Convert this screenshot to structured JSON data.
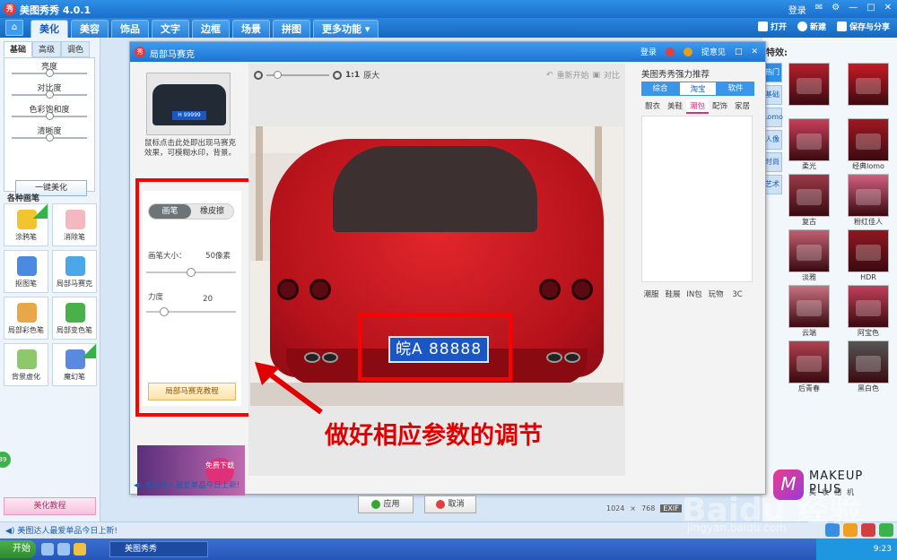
{
  "app": {
    "title": "美图秀秀 4.0.1",
    "logo_char": "秀",
    "login": "登录",
    "top_right": [
      "✉",
      "⚙",
      "—",
      "□",
      "✕"
    ]
  },
  "main_tabs": {
    "home_icon": "home-icon",
    "items": [
      "美化",
      "美容",
      "饰品",
      "文字",
      "边框",
      "场景",
      "拼图",
      "更多功能 ▾"
    ],
    "active": 0,
    "actions": {
      "open": "打开",
      "new": "新建",
      "save": "保存与分享"
    }
  },
  "left_panel": {
    "subtabs": [
      "基础",
      "高级",
      "调色"
    ],
    "sliders": [
      {
        "label": "亮度",
        "value": 0.5
      },
      {
        "label": "对比度",
        "value": 0.5
      },
      {
        "label": "色彩饱和度",
        "value": 0.5
      },
      {
        "label": "清晰度",
        "value": 0.5
      }
    ],
    "one_click": "一键美化",
    "brush_title": "各种画笔",
    "brushes": [
      {
        "label": "涂鸦笔",
        "color": "#f2c430",
        "tag": true
      },
      {
        "label": "消除笔",
        "color": "#f4b8c0",
        "tag": false
      },
      {
        "label": "抠图笔",
        "color": "#4a8ae0",
        "tag": false
      },
      {
        "label": "局部马赛克",
        "color": "#4aa8e8",
        "tag": false
      },
      {
        "label": "局部彩色笔",
        "color": "#e8a84a",
        "tag": false
      },
      {
        "label": "局部变色笔",
        "color": "#4ab04a",
        "tag": false
      },
      {
        "label": "背景虚化",
        "color": "#8ec86a",
        "tag": false
      },
      {
        "label": "魔幻笔",
        "color": "#5a8ae0",
        "tag": true
      }
    ],
    "tutorial": "美化教程",
    "badge": "39"
  },
  "dialog": {
    "title": "局部马赛克",
    "login": "登录",
    "feedback": "提意见",
    "hint": "鼠标点击此处即出现马赛克效果，可模糊水印，背景。",
    "thumb_plate": "H 99999",
    "tool_tabs": [
      "画笔",
      "橡皮擦"
    ],
    "brush_size_label": "画笔大小：",
    "brush_size_value": "50像素",
    "brush_size_level": 0.5,
    "strength_label": "力度",
    "strength_value": "20",
    "strength_level": 0.2,
    "tutorial_btn": "局部马赛克教程",
    "ad_free": "免费下载",
    "zoom_label": "1:1",
    "zoom_text": "原大",
    "restart": "重新开始",
    "compare": "对比",
    "plate_text": "皖A 88888",
    "apply": "应用",
    "cancel": "取消",
    "news": "美图达人最爱单品今日上新!",
    "recommend_title": "美图秀秀强力推荐",
    "recommend_tabs": [
      "综合",
      "淘宝",
      "软件"
    ],
    "recommend_active": 1,
    "cats_top": [
      "靓衣",
      "美鞋",
      "潮包",
      "配饰",
      "家居"
    ],
    "cats_active": 2,
    "cats_bottom": [
      "潮服",
      "鞋展",
      "IN包",
      "玩物",
      "3C"
    ]
  },
  "annotation": "做好相应参数的调节",
  "right_panel": {
    "title": "特效:",
    "categories": [
      "热门",
      "基础",
      "Lomo",
      "人像",
      "时尚",
      "艺术"
    ],
    "effects": [
      {
        "label": "",
        "color": "#b5202c"
      },
      {
        "label": "",
        "color": "#c81a24"
      },
      {
        "label": "柔光",
        "color": "#c8405a"
      },
      {
        "label": "经典lomo",
        "color": "#a01822"
      },
      {
        "label": "复古",
        "color": "#9a3a4a"
      },
      {
        "label": "粉红佳人",
        "color": "#d06080"
      },
      {
        "label": "淡雅",
        "color": "#c06070"
      },
      {
        "label": "HDR",
        "color": "#901820"
      },
      {
        "label": "云端",
        "color": "#c87080"
      },
      {
        "label": "阿宝色",
        "color": "#c0405a"
      },
      {
        "label": "后青春",
        "color": "#b04050"
      },
      {
        "label": "黑白色",
        "color": "#555555"
      }
    ]
  },
  "status": {
    "news": "美图达人最爱单品今日上新!",
    "width": "1024",
    "height": "768",
    "exif": "EXIF"
  },
  "taskbar": {
    "start": "开始",
    "task": "美图秀秀",
    "time": "9:23"
  },
  "watermark": {
    "baidu": "Baidu 经验",
    "url": "jingyan.baidu.com",
    "makeup_title": "MAKEUP PLUS",
    "makeup_sub": "美妆相机",
    "makeup_char": "M"
  }
}
